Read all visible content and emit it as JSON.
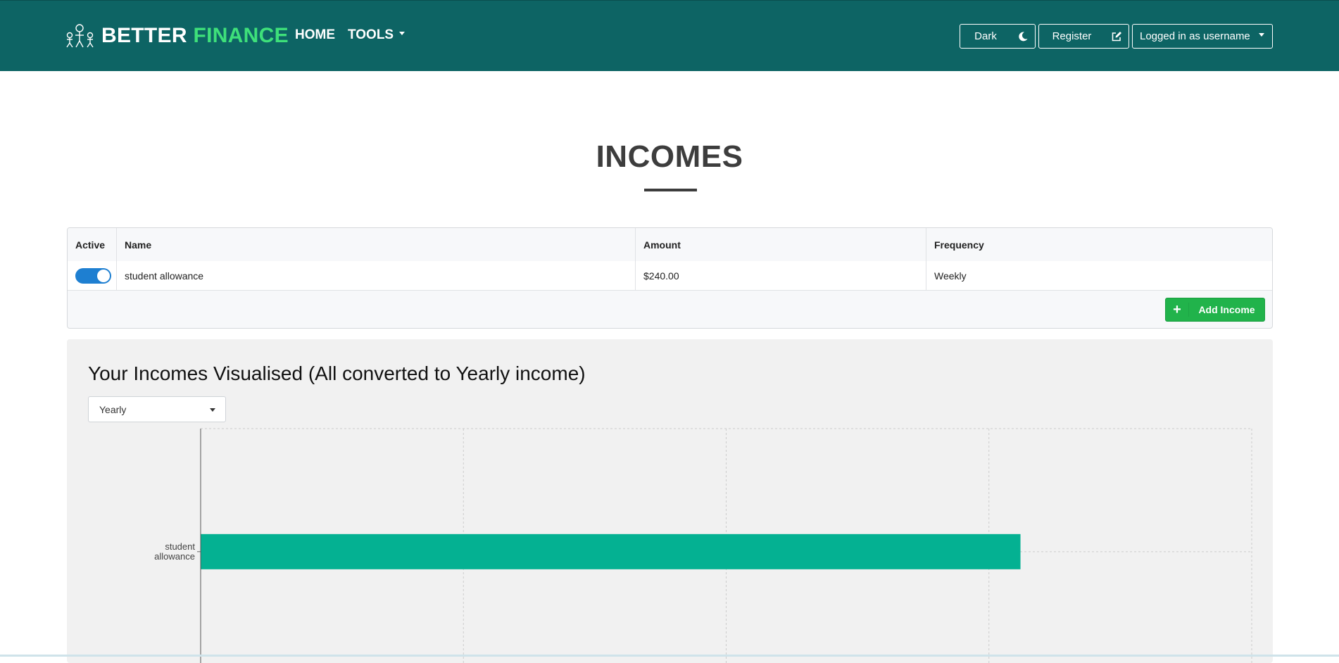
{
  "brand": {
    "part1": "BETTER",
    "part2": "FINANCE",
    "logo_icon": "stick-figures-icon",
    "accent": "#3ee07a",
    "nav_bg": "#0d6464"
  },
  "nav": {
    "home": "HOME",
    "tools": "TOOLS",
    "dark_label": "Dark",
    "dark_icon": "moon-icon",
    "register_label": "Register",
    "register_icon": "edit-icon",
    "user_label": "Logged in as username"
  },
  "page": {
    "title": "INCOMES"
  },
  "incomes_table": {
    "headers": {
      "active": "Active",
      "name": "Name",
      "amount": "Amount",
      "frequency": "Frequency"
    },
    "rows": [
      {
        "active": true,
        "name": "student allowance",
        "amount": "$240.00",
        "frequency": "Weekly"
      }
    ],
    "add_label": "Add Income"
  },
  "chart_section": {
    "title": "Your Incomes Visualised (All converted to Yearly income)",
    "period_select": "Yearly"
  },
  "chart_data": {
    "type": "bar",
    "orientation": "horizontal",
    "categories": [
      "student allowance"
    ],
    "values": [
      12480
    ],
    "xlim": [
      0,
      16000
    ],
    "grid": true,
    "bar_color": "#04b192"
  }
}
